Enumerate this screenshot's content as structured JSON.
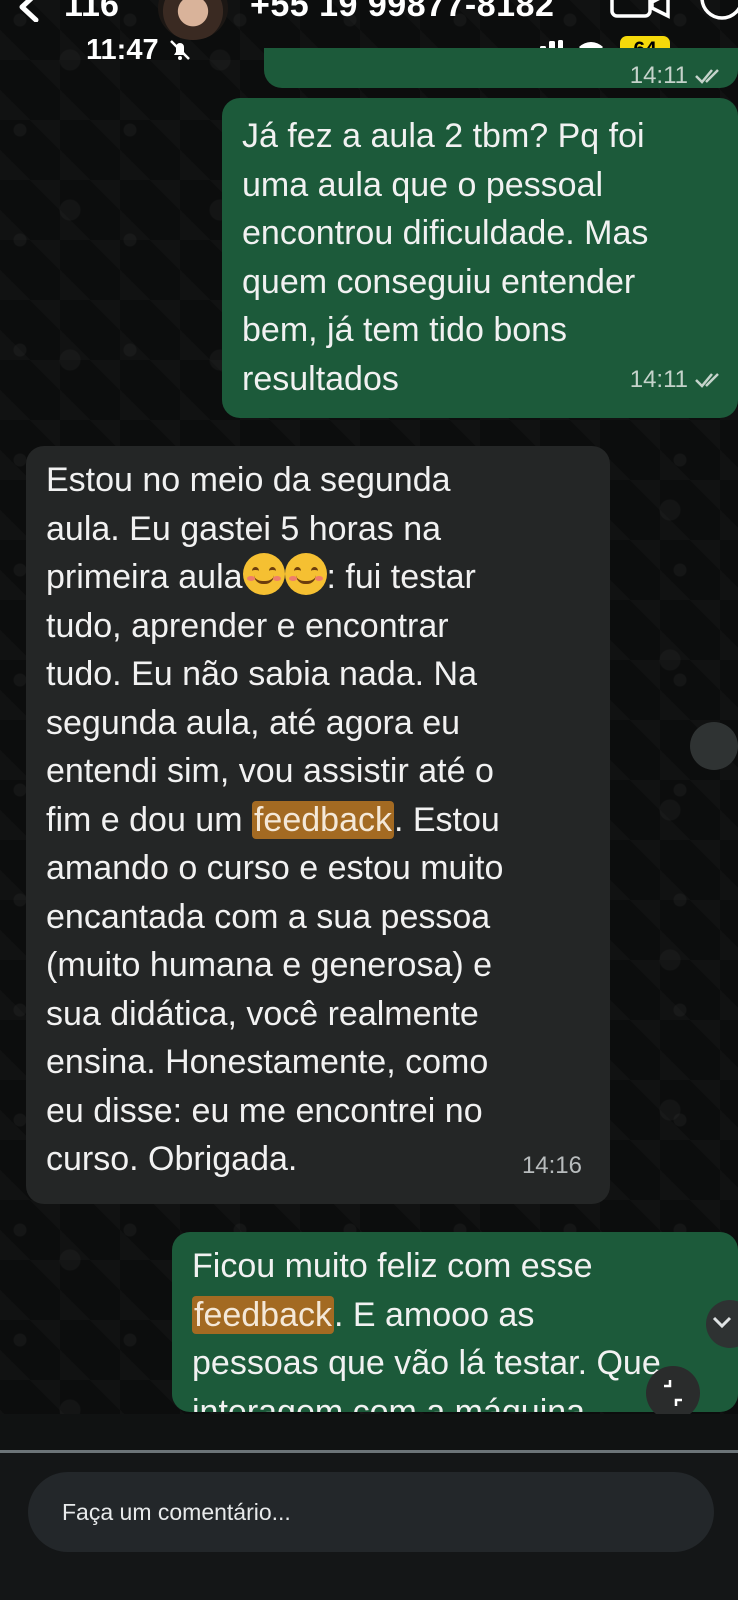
{
  "header": {
    "unread_count": "116",
    "contact_phone": "+55 19 99877-8182"
  },
  "status_bar": {
    "time": "11:47",
    "battery": "64"
  },
  "messages": [
    {
      "direction": "outgoing",
      "time": "14:11"
    },
    {
      "direction": "outgoing",
      "text": "Já fez a aula 2 tbm? Pq foi\numa aula que o pessoal\nencontrou dificuldade. Mas\nquem conseguiu entender\nbem, já tem tido bons\nresultados",
      "time": "14:11"
    },
    {
      "direction": "incoming",
      "text_part1": "Estou no meio da segunda\naula. Eu gastei 5 horas na\nprimeira aula",
      "text_part2": ": fui testar\ntudo, aprender e encontrar\ntudo. Eu não sabia nada. Na\nsegunda aula, até agora eu\nentendi sim, vou assistir até o\nfim e dou um ",
      "highlight": "feedback",
      "text_part3": ". Estou\namando o curso e estou muito\nencantada com a sua pessoa\n(muito humana e generosa) e\nsua didática, você realmente\nensina. Honestamente, como\neu disse: eu me encontrei no\ncurso. Obrigada.",
      "time": "14:16"
    },
    {
      "direction": "outgoing",
      "text_part1": "Ficou muito feliz com esse\n",
      "highlight": "feedback",
      "text_part2": ". E amooo as\npessoas que vão lá testar. Que\ninteragem com a máquina"
    }
  ],
  "comment_box": {
    "placeholder": "Faça um comentário..."
  },
  "colors": {
    "outgoing_bubble": "#1c5a3a",
    "incoming_bubble": "#242626",
    "highlight": "#a36a22",
    "battery": "#f5d90a"
  }
}
